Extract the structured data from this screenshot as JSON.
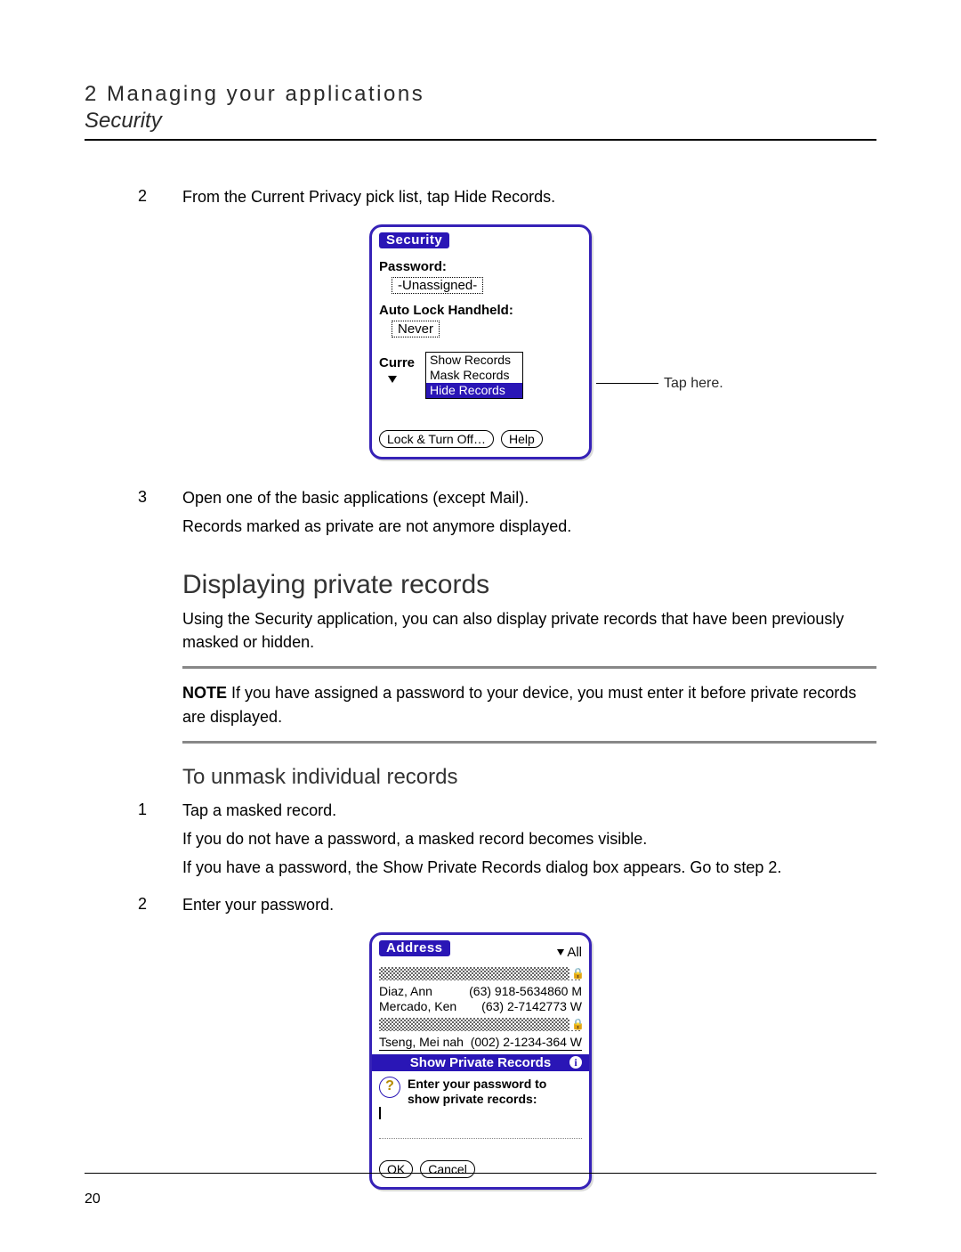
{
  "header": {
    "chapter": "2 Managing your applications",
    "section": "Security"
  },
  "step2": {
    "num": "2",
    "text": "From the Current Privacy pick list, tap Hide Records."
  },
  "palm1": {
    "title": "Security",
    "password_label": "Password:",
    "password_value": "-Unassigned-",
    "autolock_label": "Auto Lock Handheld:",
    "autolock_value": "Never",
    "curre_label": "Curre",
    "options": {
      "show": "Show Records",
      "mask": "Mask Records",
      "hide": "Hide Records"
    },
    "lock_btn": "Lock & Turn Off…",
    "help_btn": "Help",
    "callout": "Tap here."
  },
  "step3": {
    "num": "3",
    "line1": "Open one of the basic applications (except Mail).",
    "line2": "Records marked as private are not anymore displayed."
  },
  "heading2": "Displaying private records",
  "para1": "Using the Security application, you can also display private records that have been previously masked or hidden.",
  "note": {
    "label": "NOTE",
    "text": "  If you have assigned a password to your device, you must enter it before private records are displayed."
  },
  "heading3": "To unmask individual records",
  "unmask1": {
    "num": "1",
    "line1": "Tap a masked record.",
    "line2": "If you do not have a password, a masked record becomes visible.",
    "line3": "If you have a password, the Show Private Records dialog box appears. Go to step 2."
  },
  "unmask2": {
    "num": "2",
    "text": "Enter your password."
  },
  "palm2": {
    "title": "Address",
    "category": "All",
    "rows": [
      {
        "name": "Diaz, Ann",
        "phone": "(63) 918-5634860 M"
      },
      {
        "name": "Mercado, Ken",
        "phone": "(63) 2-7142773 W"
      }
    ],
    "lastrow": {
      "name": "Tseng, Mei nah",
      "phone": "(002) 2-1234-364 W"
    },
    "dialog_title": "Show Private Records",
    "prompt": "Enter your password to show private records:",
    "ok": "OK",
    "cancel": "Cancel"
  },
  "page_number": "20"
}
